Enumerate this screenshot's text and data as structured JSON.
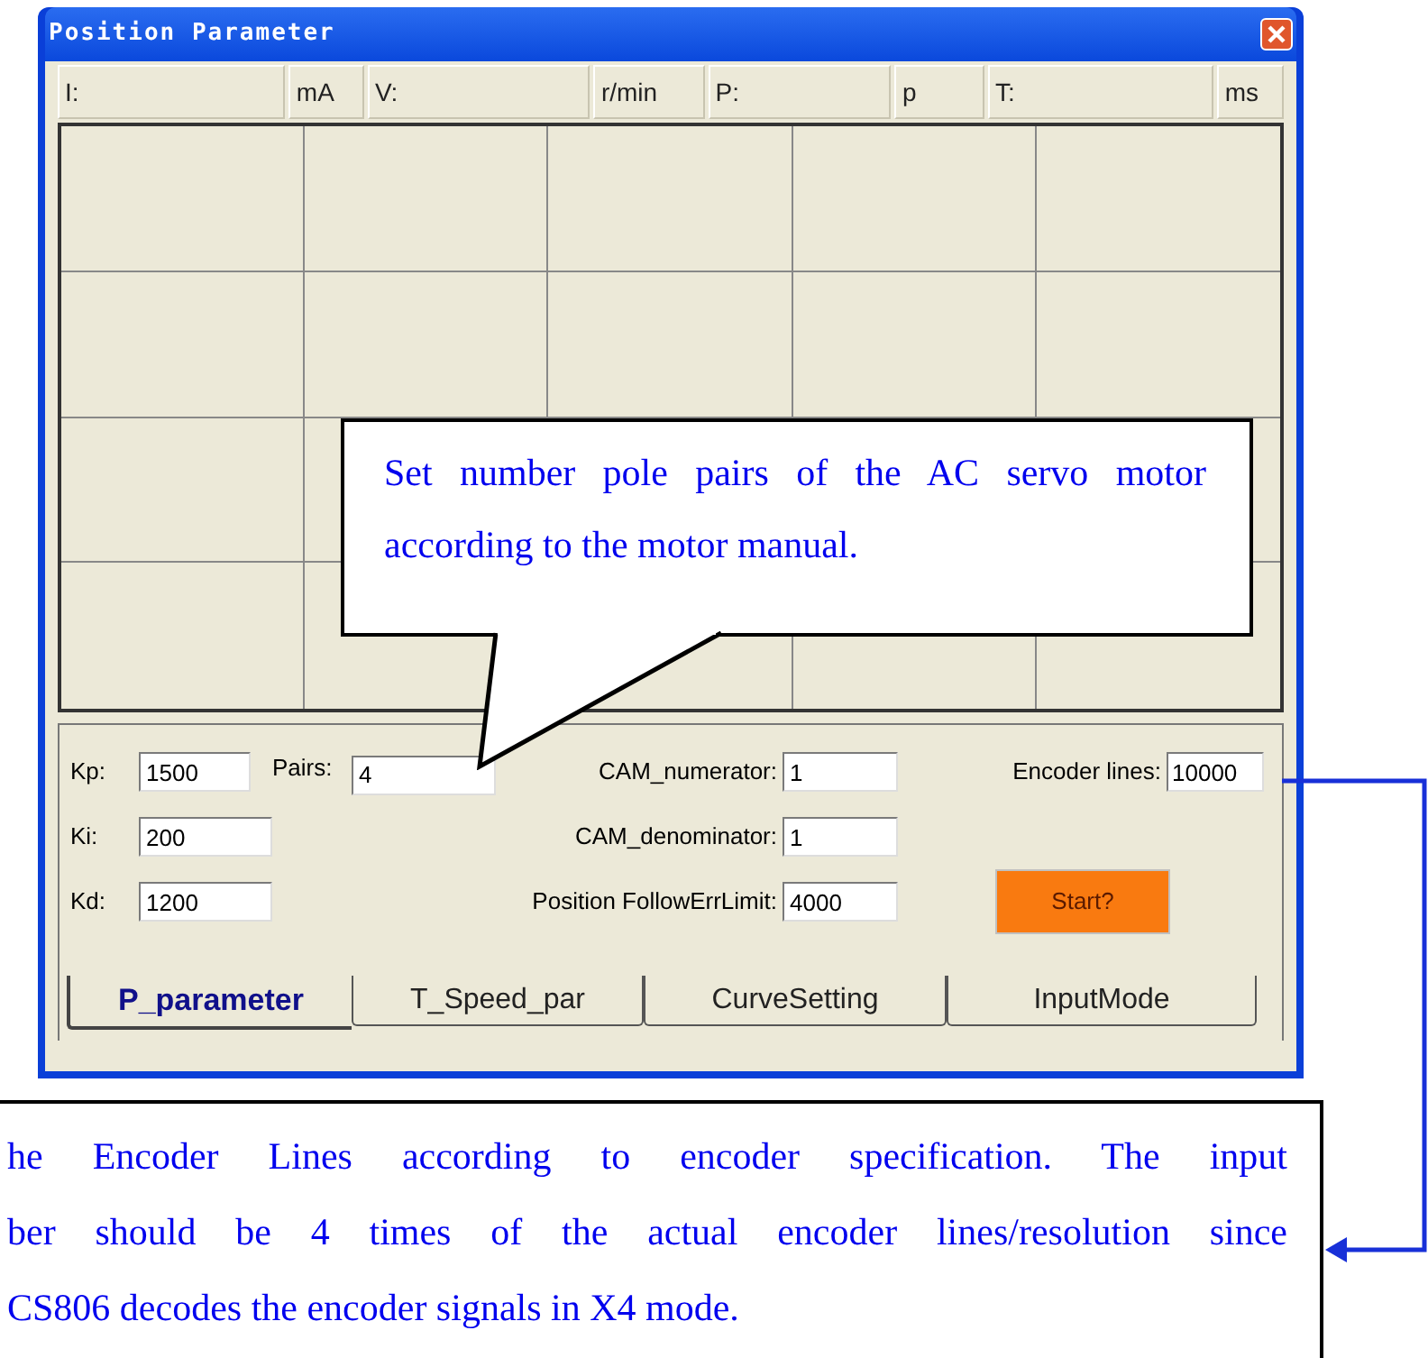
{
  "window": {
    "title": "Position Parameter"
  },
  "readouts": [
    {
      "label": "I:",
      "unit": "mA"
    },
    {
      "label": "V:",
      "unit": "r/min"
    },
    {
      "label": "P:",
      "unit": "p"
    },
    {
      "label": "T:",
      "unit": "ms"
    }
  ],
  "form": {
    "kp": {
      "label": "Kp:",
      "value": "1500"
    },
    "pairs": {
      "label": "Pairs:",
      "value": "4"
    },
    "cam_numerator": {
      "label": "CAM_numerator:",
      "value": "1"
    },
    "encoder_lines": {
      "label": "Encoder lines:",
      "value": "10000"
    },
    "ki": {
      "label": "Ki:",
      "value": "200"
    },
    "cam_denominator": {
      "label": "CAM_denominator:",
      "value": "1"
    },
    "kd": {
      "label": "Kd:",
      "value": "1200"
    },
    "follow_err_limit": {
      "label": "Position FollowErrLimit:",
      "value": "4000"
    },
    "start_button": "Start?"
  },
  "tabs": [
    {
      "label": "P_parameter",
      "selected": true
    },
    {
      "label": "T_Speed_par",
      "selected": false
    },
    {
      "label": "CurveSetting",
      "selected": false
    },
    {
      "label": "InputMode",
      "selected": false
    }
  ],
  "pairs_callout": {
    "text": "Set number pole pairs of the AC servo motor according to the motor manual."
  },
  "encoder_callout": {
    "lines": [
      "he Encoder Lines according to encoder specification. The input",
      "ber should be 4 times of the actual encoder lines/resolution since",
      "CS806 decodes the encoder signals in X4 mode."
    ]
  }
}
